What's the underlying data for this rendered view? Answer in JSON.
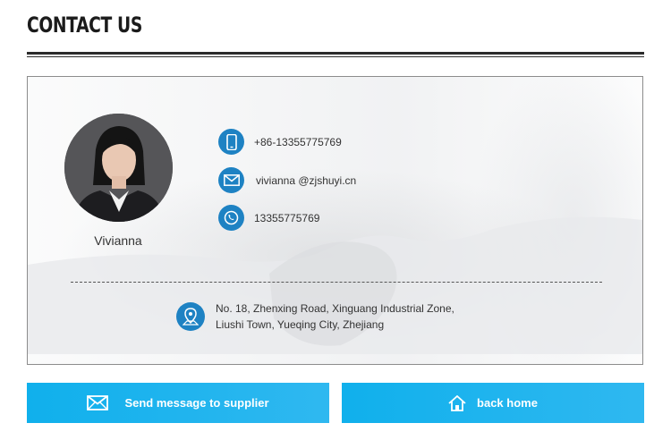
{
  "page": {
    "heading": "CONTACT US"
  },
  "card": {
    "person_name": "Vivianna",
    "phone": "+86-13355775769",
    "email": "vivianna @zjshuyi.cn",
    "whatsapp": "13355775769",
    "address_line1": "No. 18, Zhenxing Road, Xinguang Industrial Zone,",
    "address_line2": "Liushi Town, Yueqing City, Zhejiang"
  },
  "buttons": {
    "send_message": "Send message to supplier",
    "back_home": "back home"
  },
  "icons": {
    "phone": "mobile-phone-icon",
    "email": "envelope-icon",
    "whatsapp": "whatsapp-icon",
    "address": "map-pin-icon",
    "send": "envelope-icon",
    "home": "home-icon"
  },
  "colors": {
    "accent": "#1e82c3",
    "button": "#10b0ec"
  }
}
